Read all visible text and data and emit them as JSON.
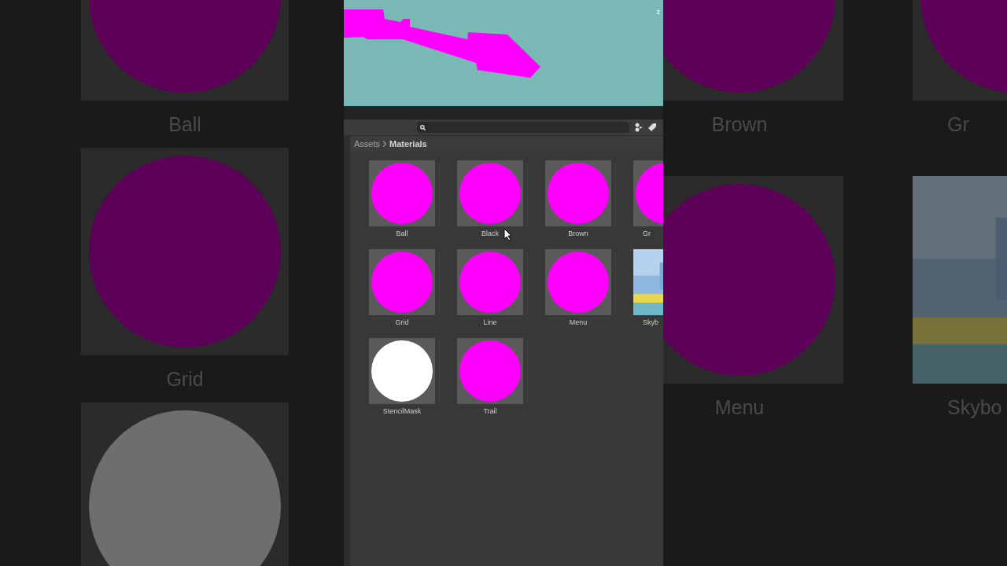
{
  "backdrop": {
    "left": [
      {
        "name": "Ball",
        "color": "#5c0058"
      },
      {
        "name": "Grid",
        "color": "#5c0058"
      },
      {
        "color": "#6e6e6e"
      }
    ],
    "right": [
      {
        "name": "Brown",
        "color": "#5c0058"
      },
      {
        "name": "Gr",
        "color": "#5c0058"
      },
      {
        "name": "Menu",
        "color": "#5c0058"
      },
      {
        "name": "Skybo",
        "kind": "picture"
      }
    ]
  },
  "scene": {
    "gizmo_label": "z"
  },
  "breadcrumb": [
    "Assets",
    "Materials"
  ],
  "assets": [
    {
      "name": "Ball",
      "kind": "material",
      "color": "#ff00ff"
    },
    {
      "name": "Black",
      "kind": "material",
      "color": "#ff00ff"
    },
    {
      "name": "Brown",
      "kind": "material",
      "color": "#ff00ff"
    },
    {
      "name": "Gr",
      "kind": "material",
      "color": "#ff00ff"
    },
    {
      "name": "Grid",
      "kind": "material",
      "color": "#ff00ff"
    },
    {
      "name": "Line",
      "kind": "material",
      "color": "#ff00ff"
    },
    {
      "name": "Menu",
      "kind": "material",
      "color": "#ff00ff"
    },
    {
      "name": "Skyb",
      "kind": "picture"
    },
    {
      "name": "StencilMask",
      "kind": "material",
      "color": "#ffffff"
    },
    {
      "name": "Trail",
      "kind": "material",
      "color": "#ff00ff"
    }
  ]
}
